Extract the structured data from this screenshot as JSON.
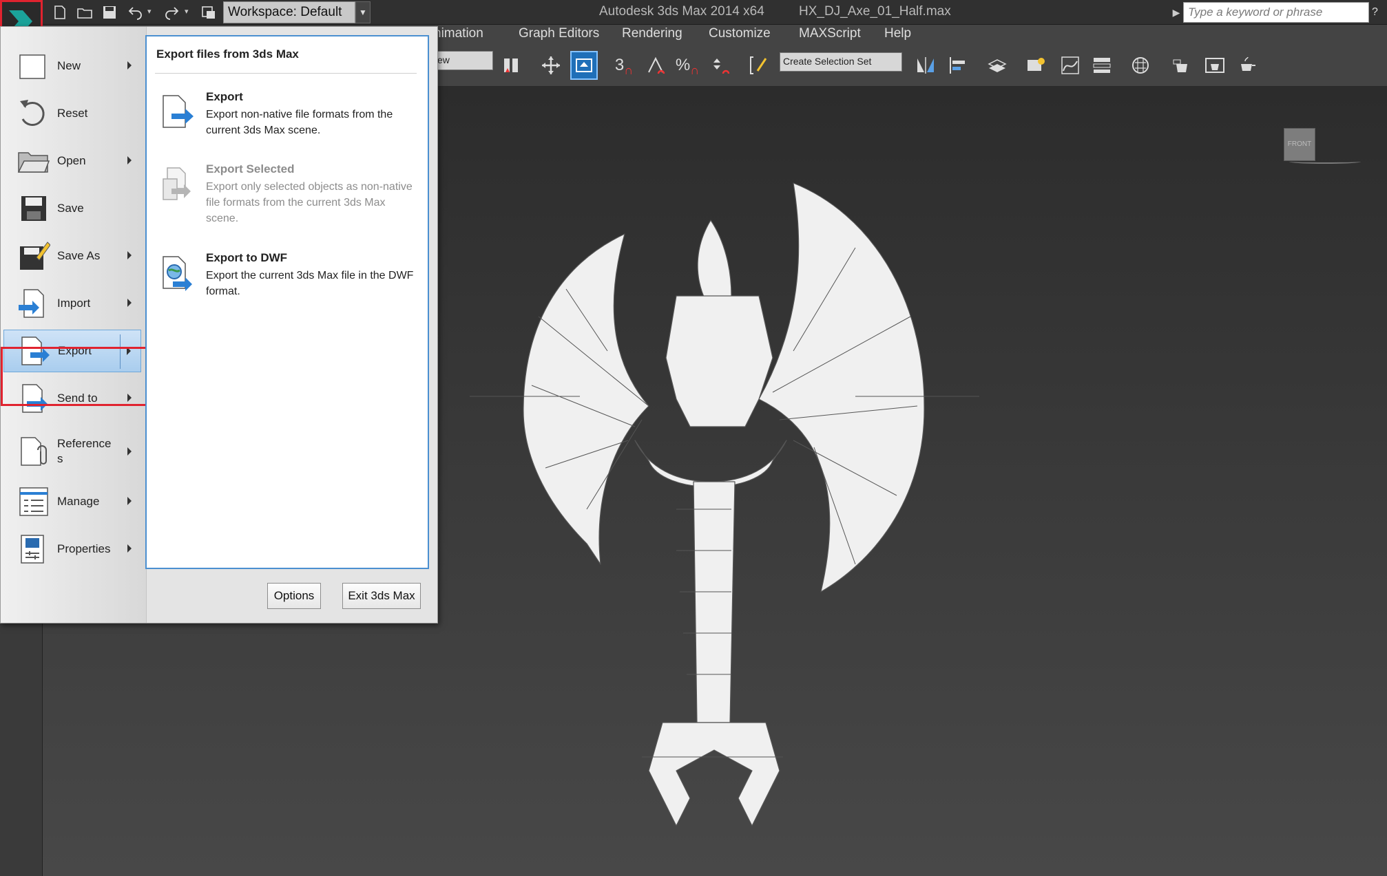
{
  "window": {
    "app_title": "Autodesk 3ds Max  2014 x64",
    "file_name": "HX_DJ_Axe_01_Half.max"
  },
  "quick_access": {
    "workspace": "Workspace: Default"
  },
  "search": {
    "placeholder": "Type a keyword or phrase"
  },
  "menubar": {
    "items": [
      "Animation",
      "Graph Editors",
      "Rendering",
      "Customize",
      "MAXScript",
      "Help"
    ],
    "partial_first": "nimation"
  },
  "toolbar": {
    "view_dropdown": "ew",
    "selection_set": "Create Selection Set",
    "snap_3": "3",
    "snap_percent": "%"
  },
  "viewport": {
    "viewcube_label": "FRONT"
  },
  "app_menu": {
    "items": [
      {
        "label": "New",
        "has_submenu": true
      },
      {
        "label": "Reset",
        "has_submenu": false
      },
      {
        "label": "Open",
        "has_submenu": true
      },
      {
        "label": "Save",
        "has_submenu": false
      },
      {
        "label": "Save As",
        "has_submenu": true
      },
      {
        "label": "Import",
        "has_submenu": true
      },
      {
        "label": "Export",
        "has_submenu": true,
        "selected": true
      },
      {
        "label": "Send to",
        "has_submenu": true
      },
      {
        "label": "Reference\ns",
        "has_submenu": true
      },
      {
        "label": "Manage",
        "has_submenu": true
      },
      {
        "label": "Properties",
        "has_submenu": true
      }
    ],
    "submenu": {
      "heading": "Export files from 3ds Max",
      "entries": [
        {
          "title": "Export",
          "desc": "Export non-native file formats from the current 3ds Max scene.",
          "enabled": true
        },
        {
          "title": "Export Selected",
          "desc": "Export only selected objects as non-native file formats from the current 3ds Max scene.",
          "enabled": false
        },
        {
          "title": "Export to DWF",
          "desc": "Export the current 3ds Max file in the DWF format.",
          "enabled": true
        }
      ]
    },
    "options_label": "Options",
    "exit_label": "Exit 3ds Max"
  },
  "colors": {
    "highlight_red": "#e0232f",
    "accent_blue": "#4a8fd0"
  }
}
